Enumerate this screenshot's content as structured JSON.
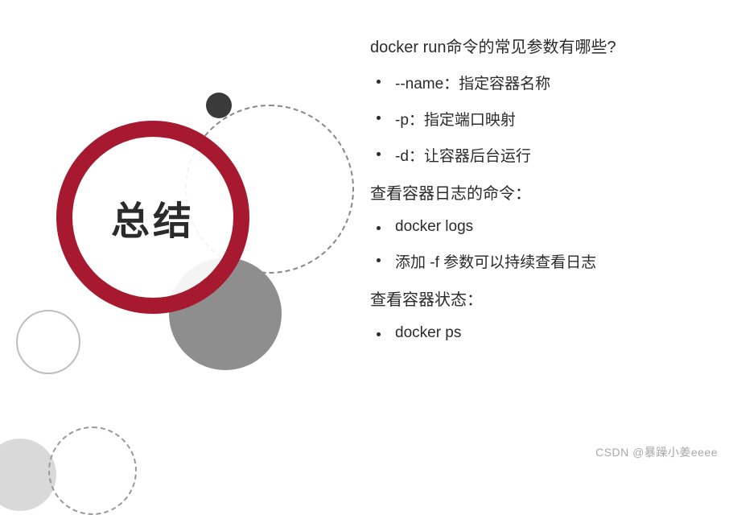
{
  "graphic": {
    "main_label": "总结"
  },
  "sections": [
    {
      "heading": "docker run命令的常见参数有哪些?",
      "bullets": [
        "--name：指定容器名称",
        "-p：指定端口映射",
        "-d：让容器后台运行"
      ]
    },
    {
      "heading": "查看容器日志的命令：",
      "bullets": [
        "docker logs",
        "添加 -f 参数可以持续查看日志"
      ]
    },
    {
      "heading": "查看容器状态：",
      "bullets": [
        "docker ps"
      ]
    }
  ],
  "watermark": "CSDN @暴躁小姜eeee"
}
